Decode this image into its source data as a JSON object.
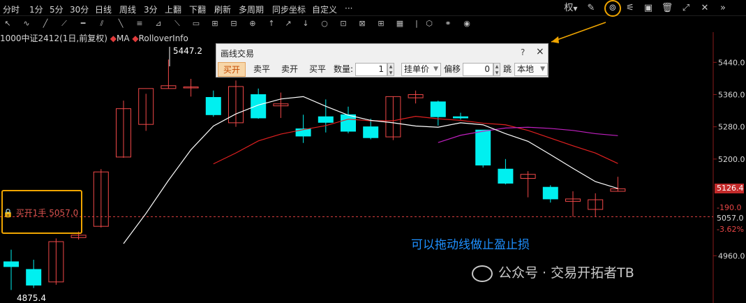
{
  "toolbar": {
    "periods": [
      "分时",
      "1分",
      "5分",
      "30分",
      "日线",
      "周线",
      "3分",
      "上翻",
      "下翻",
      "刷新",
      "多周期",
      "同步坐标",
      "自定义"
    ],
    "more": "···",
    "right_icons": [
      "authority-label",
      "pen-icon",
      "order-line-icon",
      "settings-icon",
      "layout-icon",
      "trash-icon",
      "fullscreen-icon",
      "close-icon",
      "collapse-icon"
    ],
    "authority_label": "权"
  },
  "legend": {
    "symbol": "1000中证2412(1日,前复权)",
    "items": [
      {
        "label": "MA",
        "color": "#e23b3b"
      },
      {
        "label": "RolloverInfo",
        "color": "#e23b3b"
      }
    ]
  },
  "price_axis": {
    "ticks": [
      "5440.0",
      "5360.0",
      "5280.0",
      "5200.0",
      "4960.0"
    ],
    "last_price": "5126.4",
    "change": "-190.0",
    "order_price": "5057.0",
    "change_pct": "-3.62%"
  },
  "chart_data": {
    "type": "candlestick",
    "ylim": [
      4860,
      5470
    ],
    "high_label": "5447.2",
    "low_label": "4875.4",
    "candles": [
      {
        "o": 4945,
        "h": 4975,
        "l": 4875,
        "c": 4933
      },
      {
        "o": 4926,
        "h": 4950,
        "l": 4880,
        "c": 4887
      },
      {
        "o": 4895,
        "h": 5003,
        "l": 4888,
        "c": 4995
      },
      {
        "o": 5005,
        "h": 5020,
        "l": 5000,
        "c": 5011
      },
      {
        "o": 5033,
        "h": 5175,
        "l": 5030,
        "c": 5168
      },
      {
        "o": 5205,
        "h": 5345,
        "l": 5203,
        "c": 5325
      },
      {
        "o": 5286,
        "h": 5362,
        "l": 5270,
        "c": 5375
      },
      {
        "o": 5375,
        "h": 5447,
        "l": 5375,
        "c": 5382
      },
      {
        "o": 5379,
        "h": 5399,
        "l": 5355,
        "c": 5379
      },
      {
        "o": 5353,
        "h": 5370,
        "l": 5305,
        "c": 5310
      },
      {
        "o": 5290,
        "h": 5395,
        "l": 5280,
        "c": 5380
      },
      {
        "o": 5360,
        "h": 5375,
        "l": 5300,
        "c": 5302
      },
      {
        "o": 5332,
        "h": 5365,
        "l": 5302,
        "c": 5337
      },
      {
        "o": 5275,
        "h": 5310,
        "l": 5240,
        "c": 5257
      },
      {
        "o": 5305,
        "h": 5348,
        "l": 5266,
        "c": 5291
      },
      {
        "o": 5310,
        "h": 5330,
        "l": 5264,
        "c": 5269
      },
      {
        "o": 5280,
        "h": 5300,
        "l": 5249,
        "c": 5253
      },
      {
        "o": 5255,
        "h": 5355,
        "l": 5247,
        "c": 5355
      },
      {
        "o": 5352,
        "h": 5370,
        "l": 5338,
        "c": 5360
      },
      {
        "o": 5342,
        "h": 5345,
        "l": 5283,
        "c": 5305
      },
      {
        "o": 5305,
        "h": 5315,
        "l": 5298,
        "c": 5302
      },
      {
        "o": 5272,
        "h": 5272,
        "l": 5179,
        "c": 5185
      },
      {
        "o": 5175,
        "h": 5200,
        "l": 5137,
        "c": 5140
      },
      {
        "o": 5152,
        "h": 5170,
        "l": 5105,
        "c": 5162
      },
      {
        "o": 5130,
        "h": 5135,
        "l": 5092,
        "c": 5101
      },
      {
        "o": 5095,
        "h": 5120,
        "l": 5057,
        "c": 5101
      },
      {
        "o": 5075,
        "h": 5115,
        "l": 5057,
        "c": 5099
      },
      {
        "o": 5120,
        "h": 5156,
        "l": 5119,
        "c": 5126
      }
    ],
    "ma_short": [
      null,
      null,
      null,
      null,
      null,
      4990,
      5065,
      5147,
      5223,
      5282,
      5312,
      5334,
      5349,
      5355,
      5331,
      5309,
      5296,
      5290,
      5282,
      5279,
      5290,
      5285,
      5263,
      5244,
      5211,
      5177,
      5144,
      5127
    ],
    "ma_long": [
      null,
      null,
      null,
      null,
      null,
      null,
      null,
      null,
      null,
      5188,
      5215,
      5245,
      5262,
      5273,
      5283,
      5299,
      5295,
      5295,
      5306,
      5300,
      5296,
      5289,
      5285,
      5271,
      5252,
      5233,
      5215,
      5189
    ],
    "ma_purple": [
      null,
      null,
      null,
      null,
      null,
      null,
      null,
      null,
      null,
      null,
      null,
      null,
      null,
      null,
      null,
      null,
      null,
      null,
      null,
      5241,
      5259,
      5269,
      5277,
      5279,
      5276,
      5271,
      5263,
      5258
    ]
  },
  "dialog": {
    "title": "画线交易",
    "help": "?",
    "close": "×",
    "buy_open": "买开",
    "sell_close": "卖平",
    "sell_open": "卖开",
    "buy_close": "买平",
    "qty_label": "数量:",
    "qty_value": "1",
    "order_type": "挂单价",
    "offset_label": "偏移",
    "offset_value": "0",
    "tick_label": "跳",
    "account": "本地"
  },
  "order_line": {
    "label": "买开1手 5057.0",
    "lock": "🔒"
  },
  "hint": "可以拖动线做止盈止损",
  "watermark": "公众号 · 交易开拓者TB",
  "colors": {
    "up": "#f04848",
    "down": "#00f0f0",
    "ma_short": "#ffffff",
    "ma_long": "#e02020",
    "ma_purple": "#c020c0",
    "highlight": "#f0a500",
    "hint": "#1e90ff"
  }
}
